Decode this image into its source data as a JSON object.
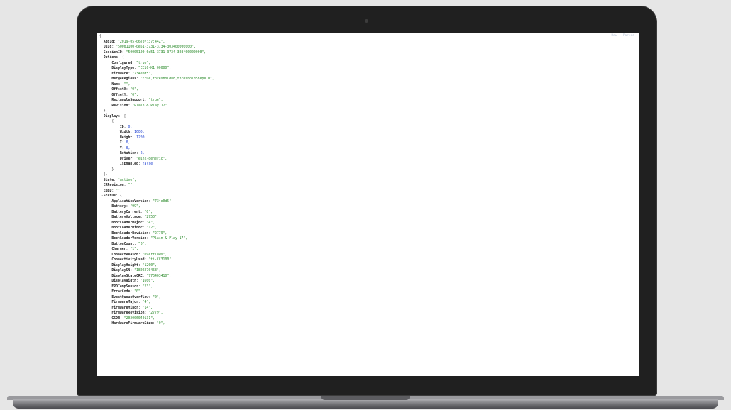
{
  "viewer": {
    "toggle_label": "Raw | Parsed"
  },
  "json_lines": [
    {
      "t": "{",
      "type": "open",
      "indent": 0
    },
    {
      "k": "AddId",
      "v": "\"2019-05-06T07:37:44Z\",",
      "type": "str",
      "indent": 1
    },
    {
      "k": "UuId",
      "v": "\"50001100-0e51-3731-3734-303400000000\",",
      "type": "str",
      "indent": 1
    },
    {
      "k": "SessionID",
      "v": "\"50005100-0e51-3731-3734-303400000000\",",
      "type": "str",
      "indent": 1
    },
    {
      "k": "Options",
      "v": "{",
      "type": "open",
      "indent": 1,
      "fold": true
    },
    {
      "k": "Configured",
      "v": "\"true\",",
      "type": "str",
      "indent": 3
    },
    {
      "k": "DisplayType",
      "v": "\"EC10-K1_00000\",",
      "type": "str",
      "indent": 3
    },
    {
      "k": "Firmware",
      "v": "\"734e0d5\",",
      "type": "str",
      "indent": 3
    },
    {
      "k": "MergeRegions",
      "v": "\"true,threshold=8,thresholdStep=10\",",
      "type": "str",
      "indent": 3
    },
    {
      "k": "Name",
      "v": "\"\",",
      "type": "str",
      "indent": 3
    },
    {
      "k": "OffsetX",
      "v": "\"0\",",
      "type": "str",
      "indent": 3
    },
    {
      "k": "OffsetY",
      "v": "\"0\",",
      "type": "str",
      "indent": 3
    },
    {
      "k": "RectangleSupport",
      "v": "\"true\",",
      "type": "str",
      "indent": 3
    },
    {
      "k": "Revision",
      "v": "\"Plain & Play 17\"",
      "type": "str",
      "indent": 3
    },
    {
      "t": "},",
      "type": "close",
      "indent": 1
    },
    {
      "k": "Displays",
      "v": "[",
      "type": "open",
      "indent": 1,
      "fold": true
    },
    {
      "t": "{",
      "type": "open",
      "indent": 3
    },
    {
      "k": "ID",
      "v": "0,",
      "type": "num",
      "indent": 5
    },
    {
      "k": "Width",
      "v": "1600,",
      "type": "num",
      "indent": 5
    },
    {
      "k": "Height",
      "v": "1200,",
      "type": "num",
      "indent": 5
    },
    {
      "k": "X",
      "v": "0,",
      "type": "num",
      "indent": 5
    },
    {
      "k": "Y",
      "v": "0,",
      "type": "num",
      "indent": 5
    },
    {
      "k": "Rotation",
      "v": "2,",
      "type": "num",
      "indent": 5
    },
    {
      "k": "Driver",
      "v": "\"eink-generic\",",
      "type": "str",
      "indent": 5
    },
    {
      "k": "IsEnabled",
      "v": "false",
      "type": "num",
      "indent": 5
    },
    {
      "t": "}",
      "type": "close",
      "indent": 3
    },
    {
      "t": "],",
      "type": "close",
      "indent": 1
    },
    {
      "k": "State",
      "v": "\"active\",",
      "type": "str",
      "indent": 1
    },
    {
      "k": "ERRevision",
      "v": "\"\",",
      "type": "str",
      "indent": 1
    },
    {
      "k": "EBBD",
      "v": "\"\",",
      "type": "str",
      "indent": 1
    },
    {
      "k": "Status",
      "v": "{",
      "type": "open",
      "indent": 1,
      "fold": true
    },
    {
      "k": "ApplicationVersion",
      "v": "\"734e0d5\",",
      "type": "str",
      "indent": 3
    },
    {
      "k": "Battery",
      "v": "\"99\",",
      "type": "str",
      "indent": 3
    },
    {
      "k": "BatteryCurrent",
      "v": "\"0\",",
      "type": "str",
      "indent": 3
    },
    {
      "k": "BatteryVoltage",
      "v": "\"2950\",",
      "type": "str",
      "indent": 3
    },
    {
      "k": "BootLoaderMajor",
      "v": "\"4\",",
      "type": "str",
      "indent": 3
    },
    {
      "k": "BootLoaderMinor",
      "v": "\"12\",",
      "type": "str",
      "indent": 3
    },
    {
      "k": "BootLoaderRevision",
      "v": "\"2779\",",
      "type": "str",
      "indent": 3
    },
    {
      "k": "BootLoaderVersion",
      "v": "\"Plain & Play 17\",",
      "type": "str",
      "indent": 3
    },
    {
      "k": "ButtonCount",
      "v": "\"0\",",
      "type": "str",
      "indent": 3
    },
    {
      "k": "Charger",
      "v": "\"1\",",
      "type": "str",
      "indent": 3
    },
    {
      "k": "ConnectReason",
      "v": "\"Overflows\",",
      "type": "str",
      "indent": 3
    },
    {
      "k": "ConnectivityUsed",
      "v": "\"ti-CC3100\",",
      "type": "str",
      "indent": 3
    },
    {
      "k": "DisplayHeight",
      "v": "\"1200\",",
      "type": "str",
      "indent": 3
    },
    {
      "k": "DisplaySN",
      "v": "\"1802270458\",",
      "type": "str",
      "indent": 3
    },
    {
      "k": "DisplayStateCRC",
      "v": "\"775403410\",",
      "type": "str",
      "indent": 3
    },
    {
      "k": "DisplayWidth",
      "v": "\"1600\",",
      "type": "str",
      "indent": 3
    },
    {
      "k": "EPDTempSensor",
      "v": "\"23\",",
      "type": "str",
      "indent": 3
    },
    {
      "k": "ErrorCode",
      "v": "\"0\",",
      "type": "str",
      "indent": 3
    },
    {
      "k": "EventQueueOverflow",
      "v": "\"0\",",
      "type": "str",
      "indent": 3
    },
    {
      "k": "FirmwareMajor",
      "v": "\"4\",",
      "type": "str",
      "indent": 3
    },
    {
      "k": "FirmwareMinor",
      "v": "\"14\",",
      "type": "str",
      "indent": 3
    },
    {
      "k": "FirmwareRevision",
      "v": "\"2779\",",
      "type": "str",
      "indent": 3
    },
    {
      "k": "GSDN",
      "v": "\"202006040131\",",
      "type": "str",
      "indent": 3
    },
    {
      "k": "HardwareFirmwareSize",
      "v": "\"0\",",
      "type": "str",
      "indent": 3
    }
  ]
}
